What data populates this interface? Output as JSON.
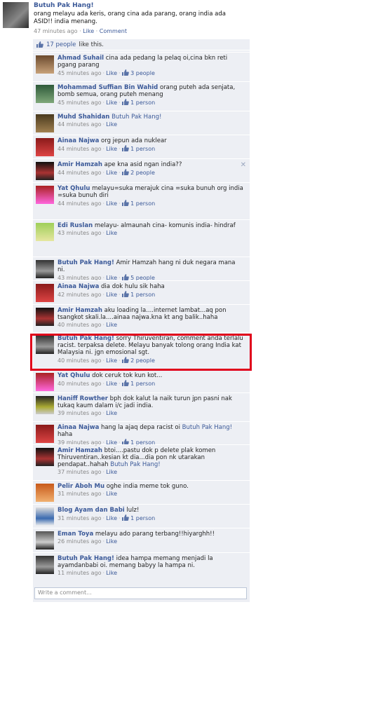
{
  "post": {
    "author": "Butuh Pak Hang!",
    "text": "orang melayu ada keris, orang cina ada parang, orang india ada ASID!! india menang.",
    "time": "47 minutes ago",
    "like_label": "Like",
    "comment_label": "Comment"
  },
  "likes": {
    "count_text": "17 people",
    "suffix": "like this."
  },
  "comments": [
    {
      "author": "Ahmad Suhail",
      "text": "cina ada pedang la pelaq oi,cina bkn reti pgang parang",
      "time": "45 minutes ago",
      "like": "Like",
      "likes": "3 people"
    },
    {
      "author": "Mohammad Suffian Bin Wahid",
      "text": "orang puteh ada senjata, bomb semua, orang puteh menang",
      "time": "45 minutes ago",
      "like": "Like",
      "likes": "1 person"
    },
    {
      "author": "Muhd Shahidan",
      "text": "",
      "mention": "Butuh Pak Hang!",
      "time": "44 minutes ago",
      "like": "Like",
      "likes": ""
    },
    {
      "author": "Ainaa Najwa",
      "text": "org jepun ada nuklear",
      "time": "44 minutes ago",
      "like": "Like",
      "likes": "1 person"
    },
    {
      "author": "Amir Hamzah",
      "text": "ape kna asid ngan india??",
      "time": "44 minutes ago",
      "like": "Like",
      "likes": "2 people"
    },
    {
      "author": "Yat Qhulu",
      "text": "melayu=suka merajuk cina =suka bunuh org india =suka bunuh diri",
      "time": "44 minutes ago",
      "like": "Like",
      "likes": "1 person"
    },
    {
      "author": "Edi Ruslan",
      "text": "melayu- almaunah cina- komunis india- hindraf",
      "time": "43 minutes ago",
      "like": "Like",
      "likes": ""
    },
    {
      "author": "Butuh Pak Hang!",
      "text": "Amir Hamzah hang ni duk negara mana ni.",
      "time": "43 minutes ago",
      "like": "Like",
      "likes": "5 people"
    },
    {
      "author": "Ainaa Najwa",
      "text": "dia dok hulu sik haha",
      "time": "42 minutes ago",
      "like": "Like",
      "likes": "1 person"
    },
    {
      "author": "Amir Hamzah",
      "text": "aku loading la....internet lambat...aq pon tsangkot skali.la....ainaa najwa.kna kt ang balik..haha",
      "time": "40 minutes ago",
      "like": "Like",
      "likes": ""
    },
    {
      "author": "Butuh Pak Hang!",
      "text": "sorry Thiruventiran, comment anda terlalu racist. terpaksa delete. Melayu banyak tolong orang India kat Malaysia ni. jgn emosional sgt.",
      "time": "40 minutes ago",
      "like": "Like",
      "likes": "2 people"
    },
    {
      "author": "Yat Qhulu",
      "text": "dok ceruk tok kun kot...",
      "time": "40 minutes ago",
      "like": "Like",
      "likes": "1 person"
    },
    {
      "author": "Haniff Rowther",
      "text": "bph dok kalut la naik turun jpn pasni nak tukaq kaum dalam i/c jadi india.",
      "time": "39 minutes ago",
      "like": "Like",
      "likes": ""
    },
    {
      "author": "Ainaa Najwa",
      "text": "hang la ajaq depa racist oi",
      "mention": "Butuh Pak Hang!",
      "tail": "haha",
      "time": "39 minutes ago",
      "like": "Like",
      "likes": "1 person"
    },
    {
      "author": "Amir Hamzah",
      "text": "btoi....pastu dok p delete plak komen Thiruventiran..kesian kt dia...dia pon nk utarakan pendapat..hahah",
      "mention": "Butuh Pak Hang!",
      "time": "37 minutes ago",
      "like": "Like",
      "likes": ""
    },
    {
      "author": "Pelir Aboh Mu",
      "text": "oghe india meme tok guno.",
      "time": "31 minutes ago",
      "like": "Like",
      "likes": ""
    },
    {
      "author": "Blog Ayam dan Babi",
      "text": "lulz!",
      "time": "31 minutes ago",
      "like": "Like",
      "likes": "1 person"
    },
    {
      "author": "Eman Toya",
      "text": "melayu ado parang terbang!!hiyarghh!!",
      "time": "26 minutes ago",
      "like": "Like",
      "likes": ""
    },
    {
      "author": "Butuh Pak Hang!",
      "text": "idea hampa memang menjadi la ayamdanbabi oi. memang babyy la hampa ni.",
      "time": "11 minutes ago",
      "like": "Like",
      "likes": ""
    }
  ],
  "composer": {
    "placeholder": "Write a comment..."
  },
  "colors": {
    "link": "#3b5998",
    "panel": "#edeff4",
    "highlight": "#e0001b"
  },
  "icons": {
    "like": "thumbs-up-icon",
    "remove": "close-icon"
  }
}
